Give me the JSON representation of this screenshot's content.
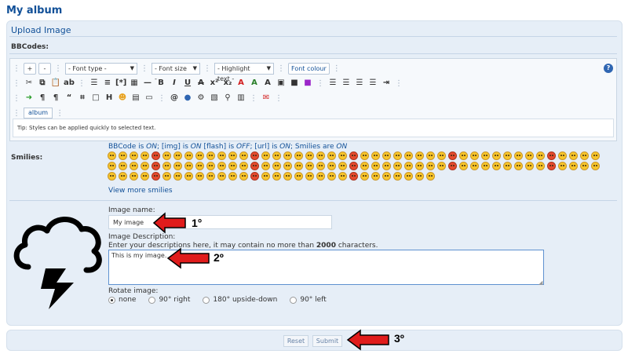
{
  "page": {
    "title": "My album"
  },
  "upload": {
    "title": "Upload Image",
    "bbcodes_label": "BBCodes:"
  },
  "toolbar": {
    "plus": "+",
    "minus": "-",
    "font_type": "- Font type -",
    "font_size": "- Font size -",
    "highlight": "- Highlight text -",
    "font_colour": "Font colour",
    "album": "album",
    "tip": "Tip: Styles can be applied quickly to selected text."
  },
  "smilies": {
    "label": "Smilies:",
    "view_more": "View more smilies",
    "status": {
      "bbcode_pre": "BBCode is ",
      "on1": "ON",
      "img_pre": "; [img] is ",
      "on2": "ON",
      "flash_pre": " [flash] is ",
      "off": "OFF",
      "url_pre": "; [url] is ",
      "on3": "ON",
      "smilies_pre": "; Smilies are ",
      "on4": "ON"
    }
  },
  "form": {
    "image_name_label": "Image name:",
    "image_name_value": "My image",
    "description_label": "Image Description:",
    "description_help_pre": "Enter your descriptions here, it may contain no more than ",
    "description_help_max": "2000",
    "description_help_post": " characters.",
    "description_value": "This is my image.",
    "rotate_label": "Rotate image:",
    "rotate_options": [
      "none",
      "90° right",
      "180° upside-down",
      "90° left"
    ],
    "rotate_selected": "none"
  },
  "buttons": {
    "reset": "Reset",
    "submit": "Submit"
  },
  "annotations": {
    "label1": "1°",
    "label2": "2º",
    "label3": "3º"
  },
  "colors": {
    "accent": "#115098",
    "arrow": "#e01c1c",
    "panel": "#e6eef7"
  }
}
